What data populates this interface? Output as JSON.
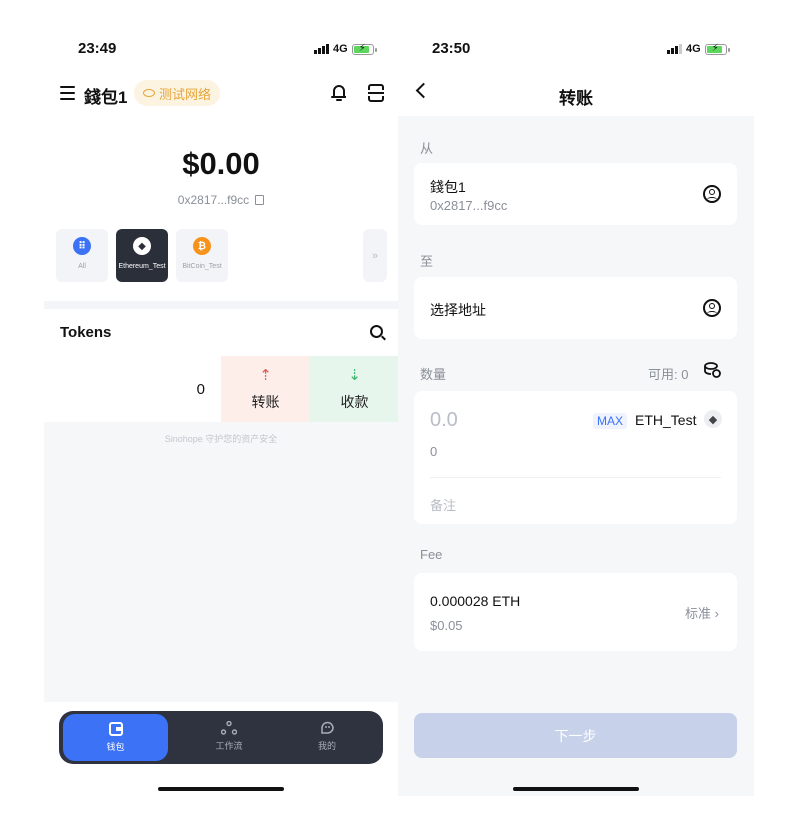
{
  "left": {
    "status": {
      "time": "23:49",
      "network": "4G"
    },
    "header": {
      "wallet_name": "錢包1",
      "network_badge": "测试网络"
    },
    "balance": "$0.00",
    "address": "0x2817...f9cc",
    "chains": [
      {
        "label": "All",
        "color": "#3b72f6"
      },
      {
        "label": "Ethereum_Test",
        "color": "#ffffff",
        "active": true
      },
      {
        "label": "BitCoin_Test",
        "color": "#f7931a"
      }
    ],
    "more": "»",
    "tokens": {
      "title": "Tokens",
      "value": "0",
      "send_label": "转账",
      "receive_label": "收款"
    },
    "footer_note": "Sinohope 守护您的资产安全",
    "tabbar": {
      "wallet": "钱包",
      "workflow": "工作流",
      "mine": "我的"
    }
  },
  "right": {
    "status": {
      "time": "23:50",
      "network": "4G"
    },
    "title": "转账",
    "from": {
      "label": "从",
      "wallet_name": "錢包1",
      "address": "0x2817...f9cc"
    },
    "to": {
      "label": "至",
      "placeholder": "选择地址"
    },
    "amount": {
      "label": "数量",
      "available": "可用: 0",
      "input_placeholder": "0.0",
      "max_label": "MAX",
      "token": "ETH_Test",
      "fiat_value": "0",
      "memo_placeholder": "备注"
    },
    "fee": {
      "label": "Fee",
      "amount": "0.000028 ETH",
      "fiat": "$0.05",
      "speed": "标准 ›"
    },
    "next_button": "下一步"
  },
  "colors": {
    "accent": "#3b72f6",
    "send": "#e25b4e",
    "receive": "#3cb46e",
    "badge": "#e6a53a"
  }
}
